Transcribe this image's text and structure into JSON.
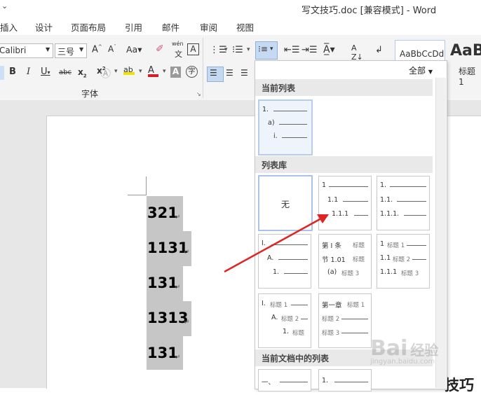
{
  "window": {
    "title": "写文技巧.doc [兼容模式] - Word",
    "quick_access": "⌄"
  },
  "menu": [
    "插入",
    "设计",
    "页面布局",
    "引用",
    "邮件",
    "审阅",
    "视图"
  ],
  "ribbon": {
    "font_name": "Calibri",
    "font_size": "三号",
    "styles_preview_1": "AaBbCcDd",
    "styles_preview_2": "AaB",
    "style_label": "标题 1",
    "font_group_label": "字体",
    "pinyin": "wén",
    "tool_icons": [
      "bold-icon",
      "italic-icon",
      "underline-icon",
      "strikethrough-icon",
      "subscript-icon",
      "superscript-icon",
      "text-effects-icon",
      "highlight-icon",
      "font-color-icon",
      "char-shading-icon",
      "enclose-char-icon",
      "align-left-icon",
      "center-icon",
      "align-right-icon"
    ],
    "colors": {
      "highlight": "#f2e200",
      "font_color": "#d42020",
      "accent": "#2b579a"
    }
  },
  "document": {
    "lines": [
      "321",
      "1131",
      "131",
      "1313",
      "131"
    ],
    "pilcrow": "↵",
    "tail_text": "技巧"
  },
  "panel": {
    "filter_label": "全部",
    "section_current": "当前列表",
    "section_library": "列表库",
    "section_document": "当前文档中的列表",
    "current_tile": [
      "1.",
      "a)",
      "i."
    ],
    "library": {
      "none_label": "无",
      "tile2": [
        "1",
        "1.1",
        "1.1.1"
      ],
      "tile3": [
        "1.",
        "1.1.",
        "1.1.1."
      ],
      "tile4": [
        "Ⅰ.",
        "A.",
        "1."
      ],
      "tile5": {
        "l1": "第 Ⅰ 条",
        "l1b": "标题",
        "l2": "节 1.01",
        "l2b": "标题",
        "l3": "(a)",
        "l3b": "标题 3"
      },
      "tile6": {
        "l1": "1",
        "l1b": "标题 1",
        "l2": "1.1",
        "l2b": "标题 2",
        "l3": "1.1.1",
        "l3b": "标题 3"
      },
      "tile7": {
        "l1": "Ⅰ.",
        "l1b": "标题 1",
        "l2": "A.",
        "l2b": "标题 2",
        "l3": "1.",
        "l3b": "标题"
      },
      "tile8": {
        "l1": "第一章",
        "l1b": "标题 1",
        "l2": "标题 2",
        "l3": "标题 3"
      }
    },
    "doc_lists": [
      "一、",
      "1."
    ]
  },
  "watermark": {
    "text": "Bai",
    "text2": "经验",
    "url": "jingyan.baidu.com"
  }
}
